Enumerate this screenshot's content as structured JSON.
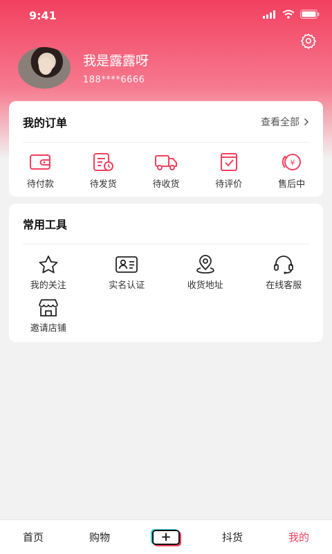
{
  "status_bar": {
    "time": "9:41"
  },
  "profile": {
    "username": "我是露露呀",
    "phone": "188****6666"
  },
  "orders": {
    "title": "我的订单",
    "see_all": "查看全部",
    "items": [
      {
        "label": "待付款",
        "icon": "wallet-icon"
      },
      {
        "label": "待发货",
        "icon": "clipboard-clock-icon"
      },
      {
        "label": "待收货",
        "icon": "truck-icon"
      },
      {
        "label": "待评价",
        "icon": "review-icon"
      },
      {
        "label": "售后中",
        "icon": "refund-icon"
      }
    ]
  },
  "tools": {
    "title": "常用工具",
    "items": [
      {
        "label": "我的关注",
        "icon": "star-icon"
      },
      {
        "label": "实名认证",
        "icon": "id-card-icon"
      },
      {
        "label": "收货地址",
        "icon": "location-pin-icon"
      },
      {
        "label": "在线客服",
        "icon": "headset-icon"
      },
      {
        "label": "邀请店铺",
        "icon": "store-icon"
      }
    ]
  },
  "tabbar": {
    "items": [
      {
        "label": "首页"
      },
      {
        "label": "购物"
      },
      {
        "label": "",
        "icon": "add-icon"
      },
      {
        "label": "抖货"
      },
      {
        "label": "我的"
      }
    ],
    "active_color": "#f2405f"
  },
  "colors": {
    "brand": "#f2405f"
  }
}
